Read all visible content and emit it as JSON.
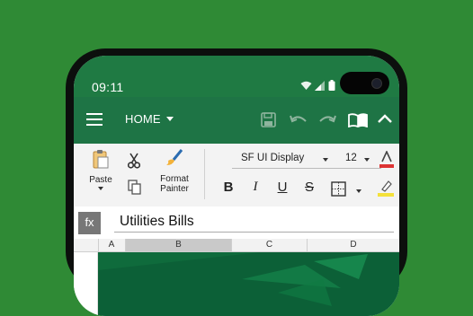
{
  "status_bar": {
    "time": "09:11"
  },
  "toolbar": {
    "tab_label": "HOME"
  },
  "ribbon": {
    "paste_label": "Paste",
    "format_painter_label": "Format Painter",
    "font_name": "SF UI Display",
    "font_size": "12",
    "bold_label": "B",
    "italic_label": "I",
    "underline_label": "U",
    "strike_label": "S"
  },
  "formula_bar": {
    "fx_label": "fx",
    "value": "Utilities Bills"
  },
  "columns": [
    "A",
    "B",
    "C",
    "D"
  ],
  "selected_column": "B",
  "colors": {
    "background": "#2f8a35",
    "toolbar": "#1e7445",
    "statusbar": "#1f7a43"
  },
  "icons": [
    "menu-icon",
    "save-icon",
    "undo-icon",
    "redo-icon",
    "book-icon",
    "collapse-icon",
    "clipboard-icon",
    "scissors-icon",
    "copy-icon",
    "brush-icon",
    "borders-icon",
    "font-color-icon",
    "highlight-icon",
    "wifi-icon",
    "signal-icon",
    "battery-icon"
  ]
}
